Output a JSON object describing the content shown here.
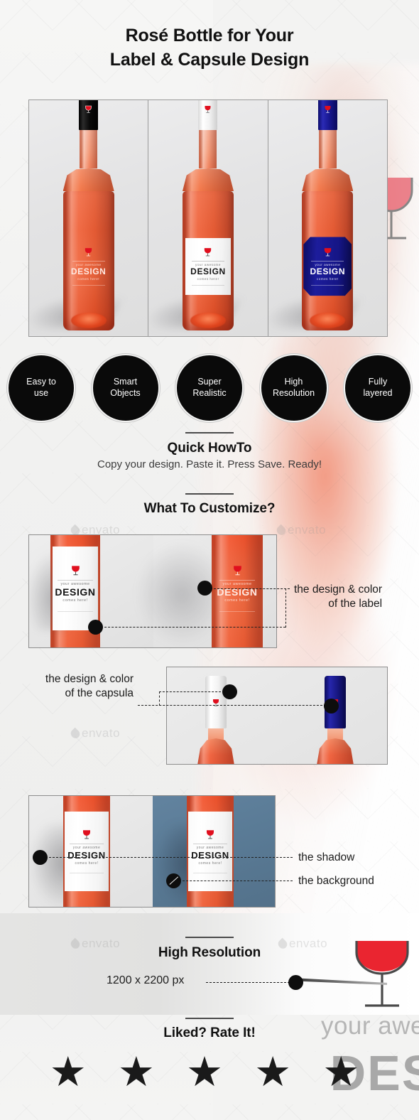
{
  "title": {
    "line1": "Rosé          Bottle for Your",
    "line2": "Label & Capsule Design"
  },
  "colors": {
    "wine": "#ef5f36",
    "capsule_black": "#0a0a0a",
    "capsule_white": "#ffffff",
    "capsule_blue": "#1515881",
    "label_blue": "#151585",
    "background_blue": "#5d7e9b",
    "badge_bg": "#0a0a0a",
    "accent_red": "#e00f1e"
  },
  "hero": {
    "panels": [
      {
        "name": "black-capsule-transparent-label",
        "capsule": "black",
        "label_style": "transparent"
      },
      {
        "name": "white-capsule-white-label",
        "capsule": "white",
        "label_style": "white"
      },
      {
        "name": "blue-capsule-blue-label",
        "capsule": "blue",
        "label_style": "blue"
      }
    ]
  },
  "label": {
    "top_text": "your awesome",
    "main_text": "DESIGN",
    "bottom_text": "comes here!",
    "icon": "wine-glass-icon"
  },
  "badges": [
    {
      "line1": "Easy to",
      "line2": "use"
    },
    {
      "line1": "Smart",
      "line2": "Objects"
    },
    {
      "line1": "Super",
      "line2": "Realistic"
    },
    {
      "line1": "High",
      "line2": "Resolution"
    },
    {
      "line1": "Fully",
      "line2": "layered"
    }
  ],
  "howto": {
    "heading": "Quick HowTo",
    "subtitle": "Copy your design. Paste it. Press Save. Ready!"
  },
  "customize": {
    "heading": "What To Customize?",
    "callouts": {
      "label": {
        "line1": "the design & color",
        "line2": "of the label"
      },
      "capsula": {
        "line1": "the design & color",
        "line2": "of the capsula"
      },
      "shadow": "the shadow",
      "background": "the background"
    }
  },
  "resolution": {
    "heading": "High Resolution",
    "value": "1200 x 2200 px"
  },
  "rate": {
    "heading": "Liked? Rate It!",
    "stars": "★ ★ ★ ★ ★",
    "star_count": 5
  },
  "watermark": {
    "text": "envato"
  },
  "decor": {
    "big_text_1": "your awes",
    "big_text_2": "DESI",
    "glass_icon": "wine-glass-icon"
  }
}
